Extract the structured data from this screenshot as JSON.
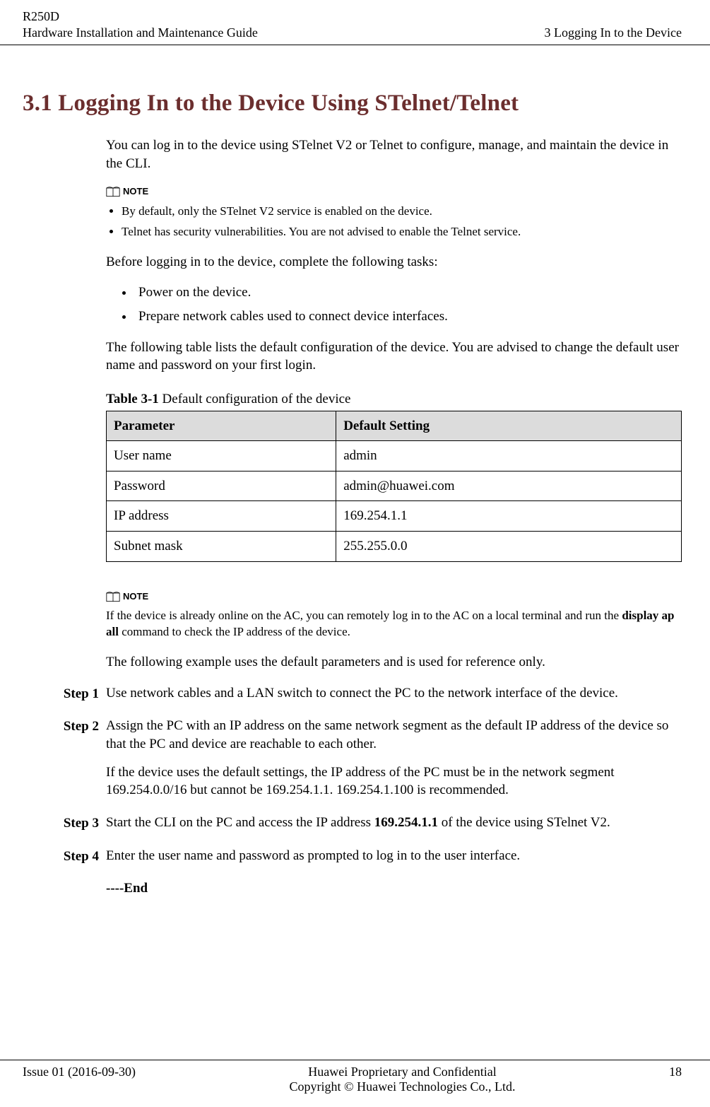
{
  "header": {
    "device": "R250D",
    "guide": "Hardware Installation and Maintenance Guide",
    "chapter": "3 Logging In to the Device"
  },
  "section": {
    "title": "3.1 Logging In to the Device Using STelnet/Telnet"
  },
  "intro": "You can log in to the device using STelnet V2 or Telnet to configure, manage, and maintain the device in the CLI.",
  "note1": {
    "label": "NOTE",
    "items": [
      "By default, only the STelnet V2 service is enabled on the device.",
      "Telnet has security vulnerabilities. You are not advised to enable the Telnet service."
    ]
  },
  "preTasksIntro": "Before logging in to the device, complete the following tasks:",
  "preTasks": [
    "Power on the device.",
    "Prepare network cables used to connect device interfaces."
  ],
  "tableIntro": "The following table lists the default configuration of the device. You are advised to change the default user name and password on your first login.",
  "table": {
    "captionBold": "Table 3-1",
    "captionRest": " Default configuration of the device",
    "headers": [
      "Parameter",
      "Default Setting"
    ],
    "rows": [
      [
        "User name",
        "admin"
      ],
      [
        "Password",
        "admin@huawei.com"
      ],
      [
        "IP address",
        "169.254.1.1"
      ],
      [
        "Subnet mask",
        "255.255.0.0"
      ]
    ]
  },
  "note2": {
    "label": "NOTE",
    "pre": "If the device is already online on the AC, you can remotely log in to the AC on a local terminal and run the ",
    "cmd": "display ap all",
    "post": " command to check the IP address of the device."
  },
  "exampleIntro": "The following example uses the default parameters and is used for reference only.",
  "steps": [
    {
      "label": "Step 1",
      "body": [
        "Use network cables and a LAN switch to connect the PC to the network interface of the device."
      ]
    },
    {
      "label": "Step 2",
      "body": [
        "Assign the PC with an IP address on the same network segment as the default IP address of the device so that the PC and device are reachable to each other.",
        "If the device uses the default settings, the IP address of the PC must be in the network segment 169.254.0.0/16 but cannot be 169.254.1.1. 169.254.1.100 is recommended."
      ]
    },
    {
      "label": "Step 3",
      "bodyPre": "Start the CLI on the PC and access the IP address ",
      "ipBold": "169.254.1.1",
      "bodyPost": " of the device using STelnet V2."
    },
    {
      "label": "Step 4",
      "body": [
        "Enter the user name and password as prompted to log in to the user interface."
      ]
    }
  ],
  "endMarker": "----End",
  "footer": {
    "issue": "Issue 01 (2016-09-30)",
    "center1": "Huawei Proprietary and Confidential",
    "center2": "Copyright © Huawei Technologies Co., Ltd.",
    "page": "18"
  }
}
